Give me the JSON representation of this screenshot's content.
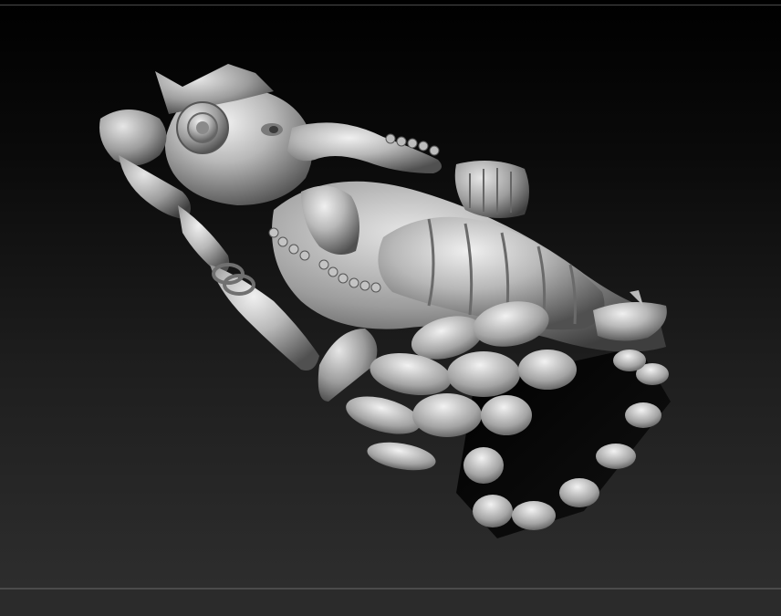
{
  "app": {
    "viewport_label": "",
    "model_name": ""
  },
  "colors": {
    "background_top": "#000000",
    "background_bottom": "#2f2f2f",
    "frame_line": "#4a4a4a",
    "bottom_bar": "#2b2b2b",
    "model_matcap_light": "#e8e8e8",
    "model_matcap_mid": "#a8a8a8",
    "model_matcap_dark": "#4a4a4a"
  },
  "icons": {
    "model": "sculpted-ganesha-model"
  }
}
